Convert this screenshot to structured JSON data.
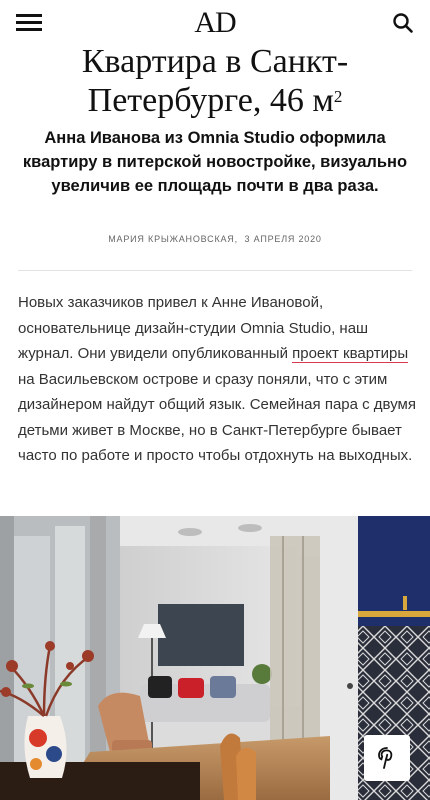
{
  "header": {
    "logo": "AD",
    "menu_icon": "hamburger-menu-icon",
    "search_icon": "search-icon"
  },
  "article": {
    "title_main": "Квартира в Санкт-Петербурге, 46 м",
    "title_sup": "2",
    "lead": "Анна Иванова из Omnia Studio оформила квартиру в питерской новостройке, визуально увеличив ее площадь почти в два раза.",
    "author": "Мария Крыжановская,",
    "date": "3 апреля 2020",
    "paragraph": {
      "before_link": "Новых заказчиков привел к Анне Ивановой, основательнице дизайн-студии Omnia Studio, наш журнал. Они увидели опубликованный ",
      "link": "проект квартиры",
      "after_link": " на Васильевском острове и сразу поняли, что с этим дизайнером найдут общий язык. Семейная пара с двумя детьми живет в Москве, но в Санкт-Петербурге бывает часто по работе и просто чтобы отдохнуть на выходных."
    }
  },
  "photo": {
    "pin_icon": "pinterest-icon"
  },
  "colors": {
    "link_underline": "#d63a55",
    "text": "#333333",
    "wall_blue": "#1f2f6b"
  }
}
